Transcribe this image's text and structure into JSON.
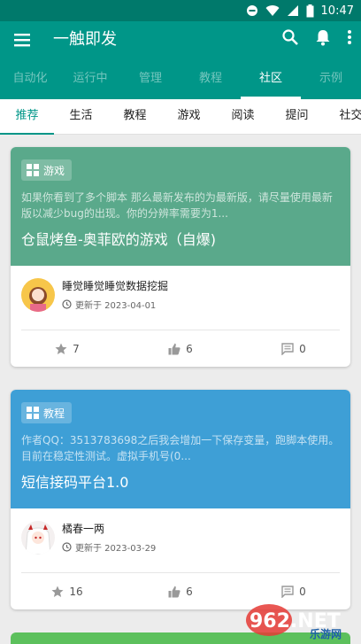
{
  "statusbar": {
    "time": "10:47"
  },
  "appbar": {
    "title": "一触即发",
    "icons": [
      "menu-icon",
      "search-icon",
      "bell-icon",
      "more-vert-icon"
    ]
  },
  "top_tabs": [
    {
      "label": "自动化",
      "active": false
    },
    {
      "label": "运行中",
      "active": false
    },
    {
      "label": "管理",
      "active": false
    },
    {
      "label": "教程",
      "active": false
    },
    {
      "label": "社区",
      "active": true
    },
    {
      "label": "示例",
      "active": false
    }
  ],
  "sub_tabs": [
    {
      "label": "推荐",
      "active": true
    },
    {
      "label": "生活",
      "active": false
    },
    {
      "label": "教程",
      "active": false
    },
    {
      "label": "游戏",
      "active": false
    },
    {
      "label": "阅读",
      "active": false
    },
    {
      "label": "提问",
      "active": false
    },
    {
      "label": "社交",
      "active": false
    }
  ],
  "cards": [
    {
      "color": "#5aa98b",
      "tag": "游戏",
      "desc": "如果你看到了多个脚本 那么最新发布的为最新版，请尽量使用最新版以减少bug的出现。你的分辨率需要为1...",
      "title": "仓鼠烤鱼-奥菲欧的游戏（自爆)",
      "author": "睡觉睡觉睡觉数据挖掘",
      "updated": "更新于 2023-04-01",
      "stars": "7",
      "likes": "6",
      "comments": "0"
    },
    {
      "color": "#3e9fd6",
      "tag": "教程",
      "desc": "作者QQ：3513783698之后我会增加一下保存变量，跑脚本使用。目前在稳定性测试。虚拟手机号(0...",
      "title": "短信接码平台1.0",
      "author": "橘春一两",
      "updated": "更新于 2023-03-29",
      "stars": "16",
      "likes": "6",
      "comments": "0"
    }
  ],
  "watermark": {
    "text": "962.NET",
    "subtext": "乐游网"
  }
}
